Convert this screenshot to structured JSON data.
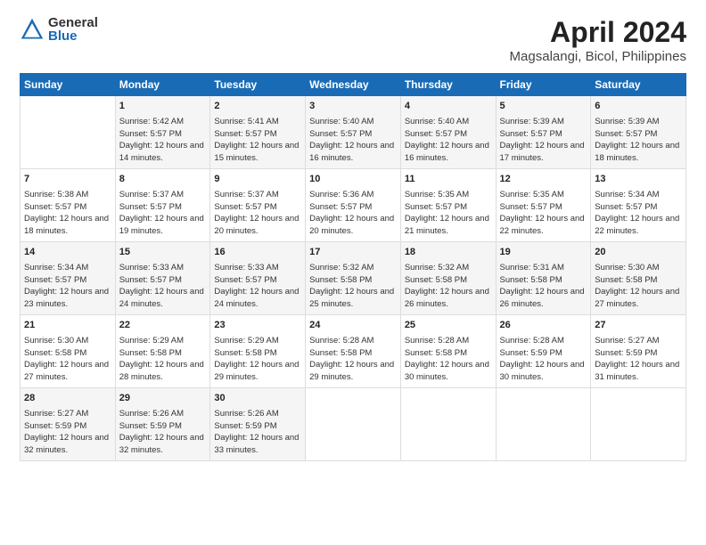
{
  "header": {
    "logo_general": "General",
    "logo_blue": "Blue",
    "main_title": "April 2024",
    "subtitle": "Magsalangi, Bicol, Philippines"
  },
  "calendar": {
    "columns": [
      "Sunday",
      "Monday",
      "Tuesday",
      "Wednesday",
      "Thursday",
      "Friday",
      "Saturday"
    ],
    "rows": [
      [
        {
          "day": "",
          "sunrise": "",
          "sunset": "",
          "daylight": ""
        },
        {
          "day": "1",
          "sunrise": "Sunrise: 5:42 AM",
          "sunset": "Sunset: 5:57 PM",
          "daylight": "Daylight: 12 hours and 14 minutes."
        },
        {
          "day": "2",
          "sunrise": "Sunrise: 5:41 AM",
          "sunset": "Sunset: 5:57 PM",
          "daylight": "Daylight: 12 hours and 15 minutes."
        },
        {
          "day": "3",
          "sunrise": "Sunrise: 5:40 AM",
          "sunset": "Sunset: 5:57 PM",
          "daylight": "Daylight: 12 hours and 16 minutes."
        },
        {
          "day": "4",
          "sunrise": "Sunrise: 5:40 AM",
          "sunset": "Sunset: 5:57 PM",
          "daylight": "Daylight: 12 hours and 16 minutes."
        },
        {
          "day": "5",
          "sunrise": "Sunrise: 5:39 AM",
          "sunset": "Sunset: 5:57 PM",
          "daylight": "Daylight: 12 hours and 17 minutes."
        },
        {
          "day": "6",
          "sunrise": "Sunrise: 5:39 AM",
          "sunset": "Sunset: 5:57 PM",
          "daylight": "Daylight: 12 hours and 18 minutes."
        }
      ],
      [
        {
          "day": "7",
          "sunrise": "Sunrise: 5:38 AM",
          "sunset": "Sunset: 5:57 PM",
          "daylight": "Daylight: 12 hours and 18 minutes."
        },
        {
          "day": "8",
          "sunrise": "Sunrise: 5:37 AM",
          "sunset": "Sunset: 5:57 PM",
          "daylight": "Daylight: 12 hours and 19 minutes."
        },
        {
          "day": "9",
          "sunrise": "Sunrise: 5:37 AM",
          "sunset": "Sunset: 5:57 PM",
          "daylight": "Daylight: 12 hours and 20 minutes."
        },
        {
          "day": "10",
          "sunrise": "Sunrise: 5:36 AM",
          "sunset": "Sunset: 5:57 PM",
          "daylight": "Daylight: 12 hours and 20 minutes."
        },
        {
          "day": "11",
          "sunrise": "Sunrise: 5:35 AM",
          "sunset": "Sunset: 5:57 PM",
          "daylight": "Daylight: 12 hours and 21 minutes."
        },
        {
          "day": "12",
          "sunrise": "Sunrise: 5:35 AM",
          "sunset": "Sunset: 5:57 PM",
          "daylight": "Daylight: 12 hours and 22 minutes."
        },
        {
          "day": "13",
          "sunrise": "Sunrise: 5:34 AM",
          "sunset": "Sunset: 5:57 PM",
          "daylight": "Daylight: 12 hours and 22 minutes."
        }
      ],
      [
        {
          "day": "14",
          "sunrise": "Sunrise: 5:34 AM",
          "sunset": "Sunset: 5:57 PM",
          "daylight": "Daylight: 12 hours and 23 minutes."
        },
        {
          "day": "15",
          "sunrise": "Sunrise: 5:33 AM",
          "sunset": "Sunset: 5:57 PM",
          "daylight": "Daylight: 12 hours and 24 minutes."
        },
        {
          "day": "16",
          "sunrise": "Sunrise: 5:33 AM",
          "sunset": "Sunset: 5:57 PM",
          "daylight": "Daylight: 12 hours and 24 minutes."
        },
        {
          "day": "17",
          "sunrise": "Sunrise: 5:32 AM",
          "sunset": "Sunset: 5:58 PM",
          "daylight": "Daylight: 12 hours and 25 minutes."
        },
        {
          "day": "18",
          "sunrise": "Sunrise: 5:32 AM",
          "sunset": "Sunset: 5:58 PM",
          "daylight": "Daylight: 12 hours and 26 minutes."
        },
        {
          "day": "19",
          "sunrise": "Sunrise: 5:31 AM",
          "sunset": "Sunset: 5:58 PM",
          "daylight": "Daylight: 12 hours and 26 minutes."
        },
        {
          "day": "20",
          "sunrise": "Sunrise: 5:30 AM",
          "sunset": "Sunset: 5:58 PM",
          "daylight": "Daylight: 12 hours and 27 minutes."
        }
      ],
      [
        {
          "day": "21",
          "sunrise": "Sunrise: 5:30 AM",
          "sunset": "Sunset: 5:58 PM",
          "daylight": "Daylight: 12 hours and 27 minutes."
        },
        {
          "day": "22",
          "sunrise": "Sunrise: 5:29 AM",
          "sunset": "Sunset: 5:58 PM",
          "daylight": "Daylight: 12 hours and 28 minutes."
        },
        {
          "day": "23",
          "sunrise": "Sunrise: 5:29 AM",
          "sunset": "Sunset: 5:58 PM",
          "daylight": "Daylight: 12 hours and 29 minutes."
        },
        {
          "day": "24",
          "sunrise": "Sunrise: 5:28 AM",
          "sunset": "Sunset: 5:58 PM",
          "daylight": "Daylight: 12 hours and 29 minutes."
        },
        {
          "day": "25",
          "sunrise": "Sunrise: 5:28 AM",
          "sunset": "Sunset: 5:58 PM",
          "daylight": "Daylight: 12 hours and 30 minutes."
        },
        {
          "day": "26",
          "sunrise": "Sunrise: 5:28 AM",
          "sunset": "Sunset: 5:59 PM",
          "daylight": "Daylight: 12 hours and 30 minutes."
        },
        {
          "day": "27",
          "sunrise": "Sunrise: 5:27 AM",
          "sunset": "Sunset: 5:59 PM",
          "daylight": "Daylight: 12 hours and 31 minutes."
        }
      ],
      [
        {
          "day": "28",
          "sunrise": "Sunrise: 5:27 AM",
          "sunset": "Sunset: 5:59 PM",
          "daylight": "Daylight: 12 hours and 32 minutes."
        },
        {
          "day": "29",
          "sunrise": "Sunrise: 5:26 AM",
          "sunset": "Sunset: 5:59 PM",
          "daylight": "Daylight: 12 hours and 32 minutes."
        },
        {
          "day": "30",
          "sunrise": "Sunrise: 5:26 AM",
          "sunset": "Sunset: 5:59 PM",
          "daylight": "Daylight: 12 hours and 33 minutes."
        },
        {
          "day": "",
          "sunrise": "",
          "sunset": "",
          "daylight": ""
        },
        {
          "day": "",
          "sunrise": "",
          "sunset": "",
          "daylight": ""
        },
        {
          "day": "",
          "sunrise": "",
          "sunset": "",
          "daylight": ""
        },
        {
          "day": "",
          "sunrise": "",
          "sunset": "",
          "daylight": ""
        }
      ]
    ]
  }
}
